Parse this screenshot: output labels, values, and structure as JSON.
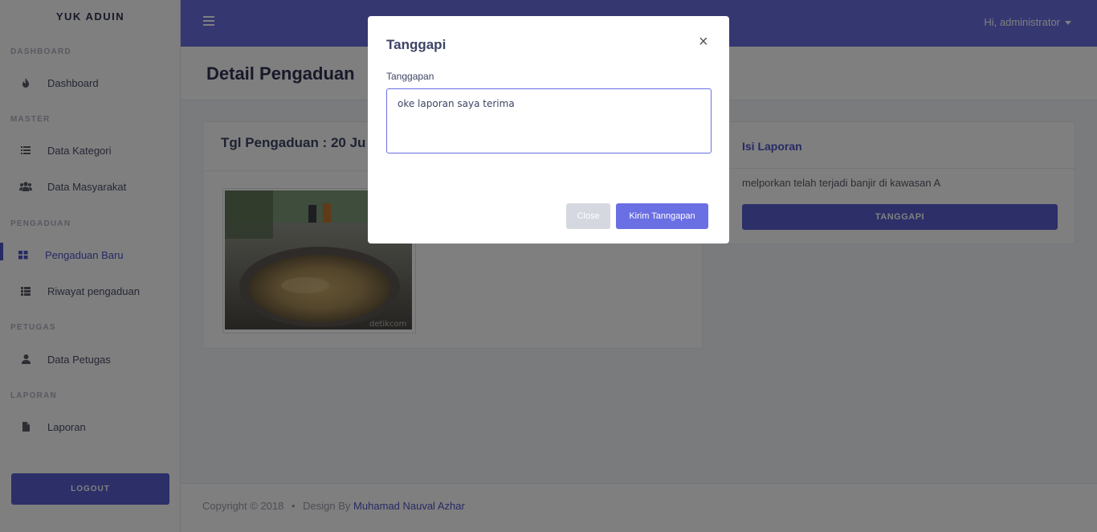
{
  "app": {
    "brand": "YUK ADUIN"
  },
  "sidebar": {
    "headings": {
      "dashboard": "DASHBOARD",
      "master": "MASTER",
      "pengaduan": "PENGADUAN",
      "petugas": "PETUGAS",
      "laporan": "LAPORAN"
    },
    "items": [
      {
        "label": "Dashboard",
        "icon": "fire-icon"
      },
      {
        "label": "Data Kategori",
        "icon": "list-icon"
      },
      {
        "label": "Data Masyarakat",
        "icon": "users-icon"
      },
      {
        "label": "Pengaduan Baru",
        "icon": "grid-icon",
        "active": true
      },
      {
        "label": "Riwayat pengaduan",
        "icon": "table-list-icon"
      },
      {
        "label": "Data Petugas",
        "icon": "user-icon"
      },
      {
        "label": "Laporan",
        "icon": "file-icon"
      }
    ],
    "logout_label": "LOGOUT"
  },
  "topbar": {
    "user_greeting": "Hi, administrator"
  },
  "page": {
    "title": "Detail Pengaduan"
  },
  "complaint": {
    "date_title": "Tgl Pengaduan : 20 Ju",
    "photo_watermark": "detikcom"
  },
  "report": {
    "title": "Isi Laporan",
    "text": "melporkan telah terjadi banjir di kawasan A",
    "respond_button": "TANGGAPI"
  },
  "footer": {
    "copyright": "Copyright © 2018",
    "separator": "•",
    "design_by": "Design By",
    "author": "Muhamad Nauval Azhar"
  },
  "modal": {
    "title": "Tanggapi",
    "close_symbol": "×",
    "field_label": "Tanggapan",
    "textarea_value": "oke laporan saya terima",
    "close_button": "Close",
    "submit_button": "Kirim Tanngapan"
  },
  "colors": {
    "accent": "#6a6fe3",
    "primary": "#5b5fd2",
    "link": "#4e54c8"
  }
}
